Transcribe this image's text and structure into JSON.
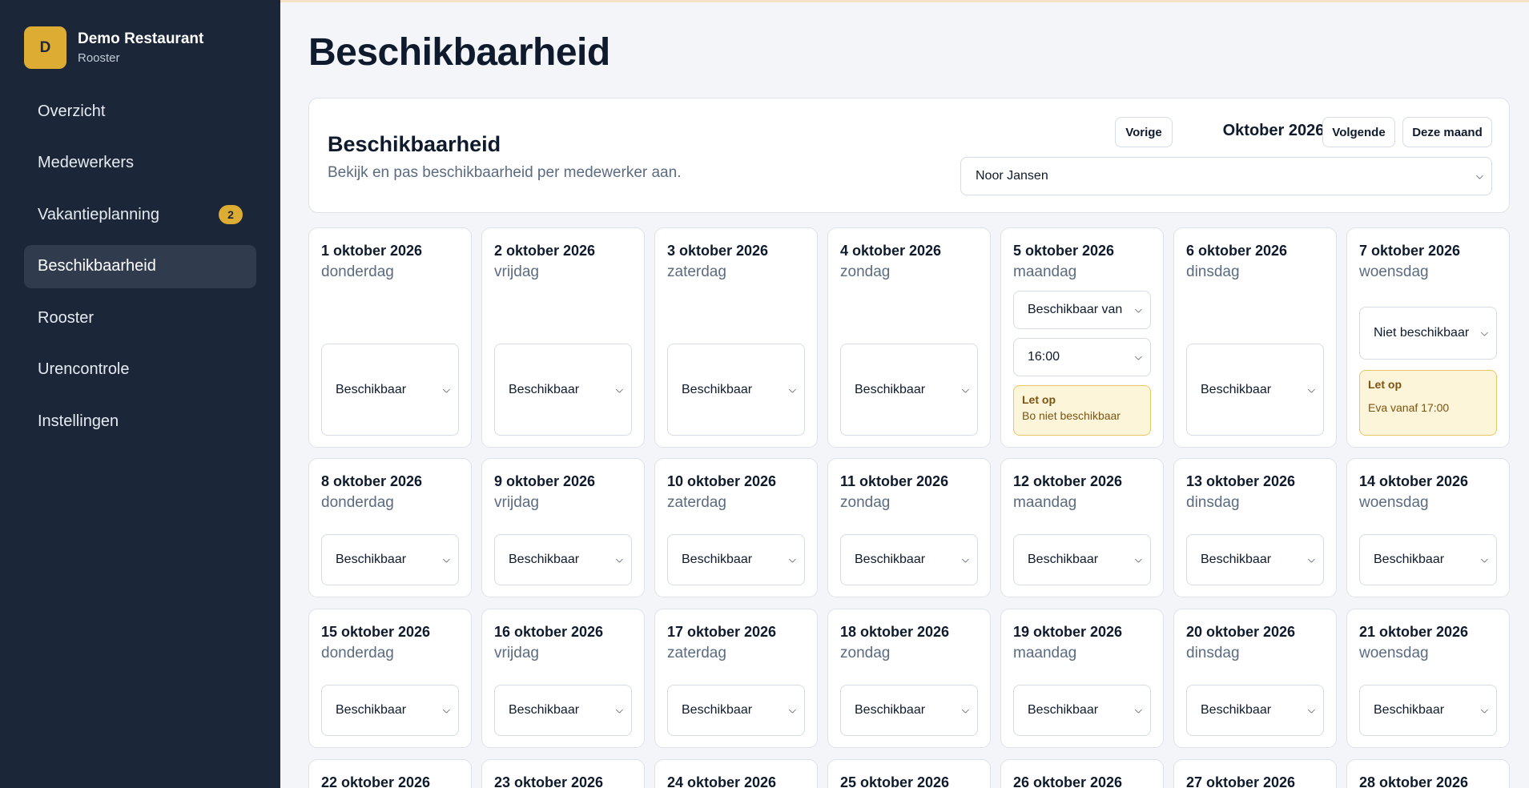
{
  "app": {
    "initial": "D",
    "name": "Demo Restaurant",
    "subtitle": "Rooster"
  },
  "nav": [
    {
      "label": "Overzicht"
    },
    {
      "label": "Medewerkers"
    },
    {
      "label": "Vakantieplanning",
      "badge": "2"
    },
    {
      "label": "Beschikbaarheid",
      "active": true
    },
    {
      "label": "Rooster"
    },
    {
      "label": "Urencontrole"
    },
    {
      "label": "Instellingen"
    }
  ],
  "page": {
    "title": "Beschikbaarheid"
  },
  "panel": {
    "title": "Beschikbaarheid",
    "subtitle": "Bekijk en pas beschikbaarheid per medewerker aan.",
    "prev": "Vorige",
    "month": "Oktober 2026",
    "next": "Volgende",
    "this_month": "Deze maand",
    "employee": "Noor Jansen"
  },
  "days": [
    {
      "date": "1 oktober 2026",
      "weekday": "donderdag",
      "status": "Beschikbaar"
    },
    {
      "date": "2 oktober 2026",
      "weekday": "vrijdag",
      "status": "Beschikbaar"
    },
    {
      "date": "3 oktober 2026",
      "weekday": "zaterdag",
      "status": "Beschikbaar"
    },
    {
      "date": "4 oktober 2026",
      "weekday": "zondag",
      "status": "Beschikbaar"
    },
    {
      "date": "5 oktober 2026",
      "weekday": "maandag",
      "status": "Beschikbaar van",
      "time": "16:00",
      "alert": {
        "title": "Let op",
        "body": "Bo niet beschikbaar"
      }
    },
    {
      "date": "6 oktober 2026",
      "weekday": "dinsdag",
      "status": "Beschikbaar"
    },
    {
      "date": "7 oktober 2026",
      "weekday": "woensdag",
      "status": "Niet beschikbaar",
      "alert": {
        "title": "Let op",
        "body": "Eva vanaf 17:00"
      }
    },
    {
      "date": "8 oktober 2026",
      "weekday": "donderdag",
      "status": "Beschikbaar"
    },
    {
      "date": "9 oktober 2026",
      "weekday": "vrijdag",
      "status": "Beschikbaar"
    },
    {
      "date": "10 oktober 2026",
      "weekday": "zaterdag",
      "status": "Beschikbaar"
    },
    {
      "date": "11 oktober 2026",
      "weekday": "zondag",
      "status": "Beschikbaar"
    },
    {
      "date": "12 oktober 2026",
      "weekday": "maandag",
      "status": "Beschikbaar"
    },
    {
      "date": "13 oktober 2026",
      "weekday": "dinsdag",
      "status": "Beschikbaar"
    },
    {
      "date": "14 oktober 2026",
      "weekday": "woensdag",
      "status": "Beschikbaar"
    },
    {
      "date": "15 oktober 2026",
      "weekday": "donderdag",
      "status": "Beschikbaar"
    },
    {
      "date": "16 oktober 2026",
      "weekday": "vrijdag",
      "status": "Beschikbaar"
    },
    {
      "date": "17 oktober 2026",
      "weekday": "zaterdag",
      "status": "Beschikbaar"
    },
    {
      "date": "18 oktober 2026",
      "weekday": "zondag",
      "status": "Beschikbaar"
    },
    {
      "date": "19 oktober 2026",
      "weekday": "maandag",
      "status": "Beschikbaar"
    },
    {
      "date": "20 oktober 2026",
      "weekday": "dinsdag",
      "status": "Beschikbaar"
    },
    {
      "date": "21 oktober 2026",
      "weekday": "woensdag",
      "status": "Beschikbaar"
    },
    {
      "date": "22 oktober 2026"
    },
    {
      "date": "23 oktober 2026"
    },
    {
      "date": "24 oktober 2026"
    },
    {
      "date": "25 oktober 2026"
    },
    {
      "date": "26 oktober 2026"
    },
    {
      "date": "27 oktober 2026"
    },
    {
      "date": "28 oktober 2026"
    }
  ]
}
